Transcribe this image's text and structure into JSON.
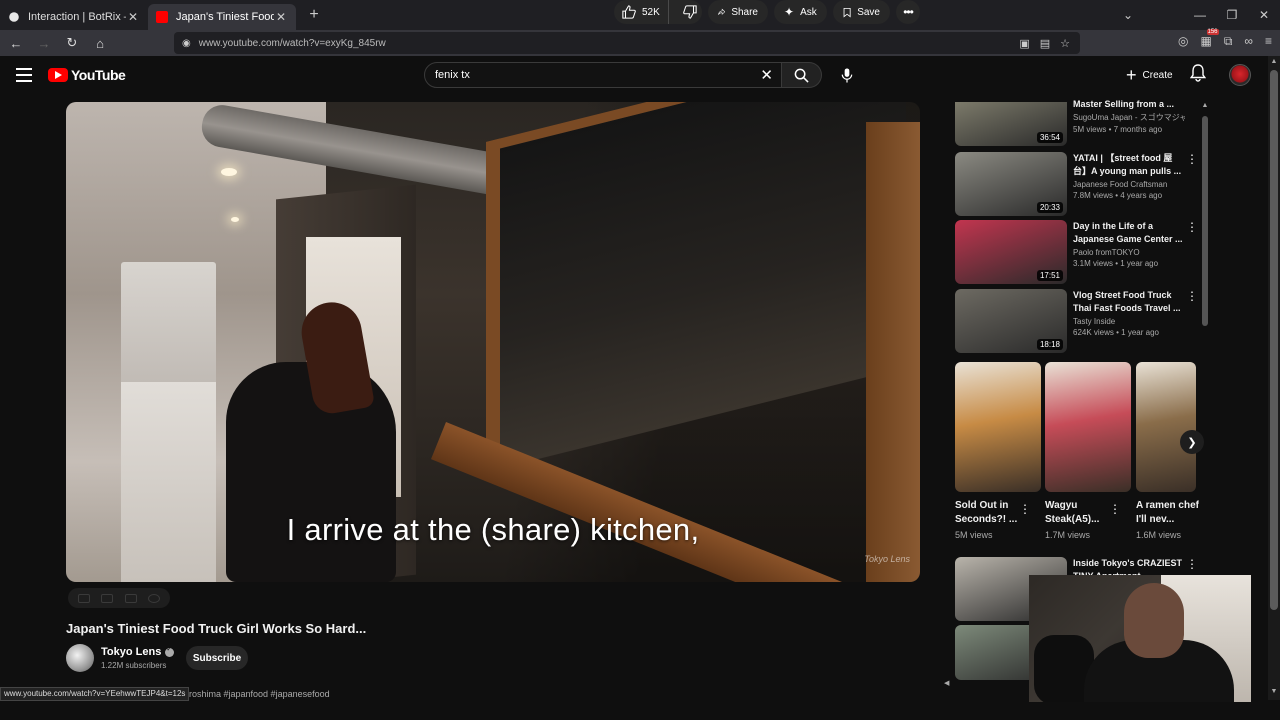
{
  "browser": {
    "tabs": [
      {
        "title": "Interaction | BotRix — Cloud",
        "active": false,
        "fav_color": "#e8e8e8"
      },
      {
        "title": "Japan's Tiniest Food Truck Girl W",
        "active": true,
        "fav_color": "#ff0000"
      }
    ],
    "url": "www.youtube.com/watch?v=exyKg_845rw",
    "ext_badge": "156"
  },
  "header": {
    "logo_text": "YouTube",
    "search_value": "fenix tx",
    "create_label": "Create"
  },
  "video": {
    "caption": "I arrive at the (share) kitchen,",
    "watermark": "Tokyo Lens",
    "title": "Japan's Tiniest Food Truck Girl Works So Hard...",
    "channel": "Tokyo Lens",
    "subscribers": "1.22M subscribers",
    "subscribe_label": "Subscribe",
    "likes": "52K",
    "share_label": "Share",
    "ask_label": "Ask",
    "save_label": "Save",
    "tags": "hiroshima #japanfood #japanesefood",
    "status_url": "www.youtube.com/watch?v=YEehwwTEJP4&t=12s"
  },
  "sidebar": {
    "recs": [
      {
        "title": "Master Selling from a ...",
        "channel": "SugoUma Japan - スゴウマジャ...",
        "meta": "5M views • 7 months ago",
        "duration": "36:54",
        "thumb": "#7c7a6a"
      },
      {
        "title": "YATAI | 【street food 屋台】A young man pulls ...",
        "channel": "Japanese Food Craftsman",
        "meta": "7.8M views • 4 years ago",
        "duration": "20:33",
        "thumb": "#8b8a82"
      },
      {
        "title": "Day in the Life of a Japanese Game Center ...",
        "channel": "Paolo fromTOKYO",
        "meta": "3.1M views • 1 year ago",
        "duration": "17:51",
        "thumb": "#c2354f"
      },
      {
        "title": "Vlog Street Food Truck Thai Fast Foods Travel ...",
        "channel": "Tasty Inside",
        "meta": "624K views • 1 year ago",
        "duration": "18:18",
        "thumb": "#6d6a62"
      },
      {
        "title": "Inside Tokyo's CRAZIEST TINY Apartment",
        "channel": "",
        "meta": "",
        "duration": "",
        "thumb": "#b9b4ab"
      }
    ],
    "shorts": [
      {
        "title": "Sold Out in Seconds?! ...",
        "views": "5M views",
        "thumb": "#c78b45"
      },
      {
        "title": "Wagyu Steak(A5)...",
        "views": "1.7M views",
        "thumb": "#c64c58"
      },
      {
        "title": "A ramen chef I'll nev...",
        "views": "1.6M views",
        "thumb": "#8a6d4a"
      }
    ]
  }
}
